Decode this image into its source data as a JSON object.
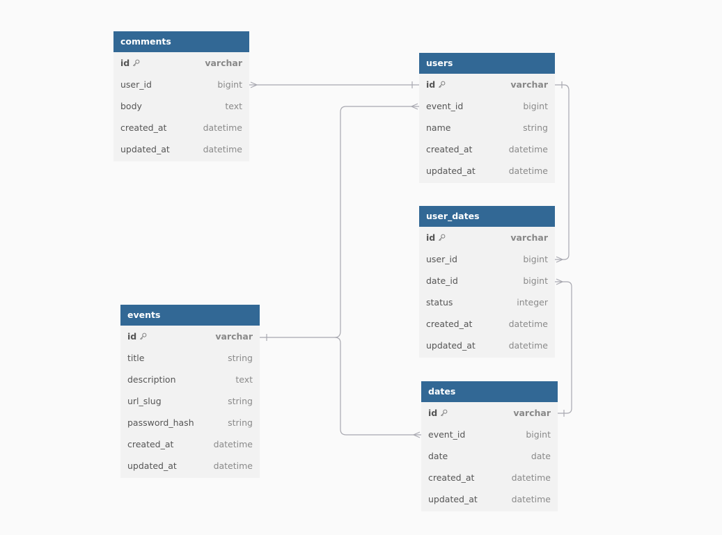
{
  "diagram": {
    "colors": {
      "header_bg": "#326895",
      "header_text": "#ffffff",
      "body_bg": "#f2f2f2",
      "canvas_bg": "#fafafa",
      "link": "#a8a8b0"
    },
    "tables": [
      {
        "id": "comments",
        "name": "comments",
        "columns": [
          {
            "name": "id",
            "type": "varchar",
            "pk": true
          },
          {
            "name": "user_id",
            "type": "bigint"
          },
          {
            "name": "body",
            "type": "text"
          },
          {
            "name": "created_at",
            "type": "datetime"
          },
          {
            "name": "updated_at",
            "type": "datetime"
          }
        ]
      },
      {
        "id": "users",
        "name": "users",
        "columns": [
          {
            "name": "id",
            "type": "varchar",
            "pk": true
          },
          {
            "name": "event_id",
            "type": "bigint"
          },
          {
            "name": "name",
            "type": "string"
          },
          {
            "name": "created_at",
            "type": "datetime"
          },
          {
            "name": "updated_at",
            "type": "datetime"
          }
        ]
      },
      {
        "id": "user_dates",
        "name": "user_dates",
        "columns": [
          {
            "name": "id",
            "type": "varchar",
            "pk": true
          },
          {
            "name": "user_id",
            "type": "bigint"
          },
          {
            "name": "date_id",
            "type": "bigint"
          },
          {
            "name": "status",
            "type": "integer"
          },
          {
            "name": "created_at",
            "type": "datetime"
          },
          {
            "name": "updated_at",
            "type": "datetime"
          }
        ]
      },
      {
        "id": "events",
        "name": "events",
        "columns": [
          {
            "name": "id",
            "type": "varchar",
            "pk": true
          },
          {
            "name": "title",
            "type": "string"
          },
          {
            "name": "description",
            "type": "text"
          },
          {
            "name": "url_slug",
            "type": "string"
          },
          {
            "name": "password_hash",
            "type": "string"
          },
          {
            "name": "created_at",
            "type": "datetime"
          },
          {
            "name": "updated_at",
            "type": "datetime"
          }
        ]
      },
      {
        "id": "dates",
        "name": "dates",
        "columns": [
          {
            "name": "id",
            "type": "varchar",
            "pk": true
          },
          {
            "name": "event_id",
            "type": "bigint"
          },
          {
            "name": "date",
            "type": "date"
          },
          {
            "name": "created_at",
            "type": "datetime"
          },
          {
            "name": "updated_at",
            "type": "datetime"
          }
        ]
      }
    ],
    "relationships": [
      {
        "from": "comments.user_id",
        "to": "users.id",
        "from_card": "many",
        "to_card": "one"
      },
      {
        "from": "users.event_id",
        "to": "events.id",
        "from_card": "many",
        "to_card": "one"
      },
      {
        "from": "user_dates.user_id",
        "to": "users.id",
        "from_card": "many",
        "to_card": "one"
      },
      {
        "from": "user_dates.date_id",
        "to": "dates.id",
        "from_card": "many",
        "to_card": "one"
      },
      {
        "from": "dates.event_id",
        "to": "events.id",
        "from_card": "many",
        "to_card": "one"
      }
    ],
    "icons": {
      "primary_key": "key-icon"
    }
  }
}
